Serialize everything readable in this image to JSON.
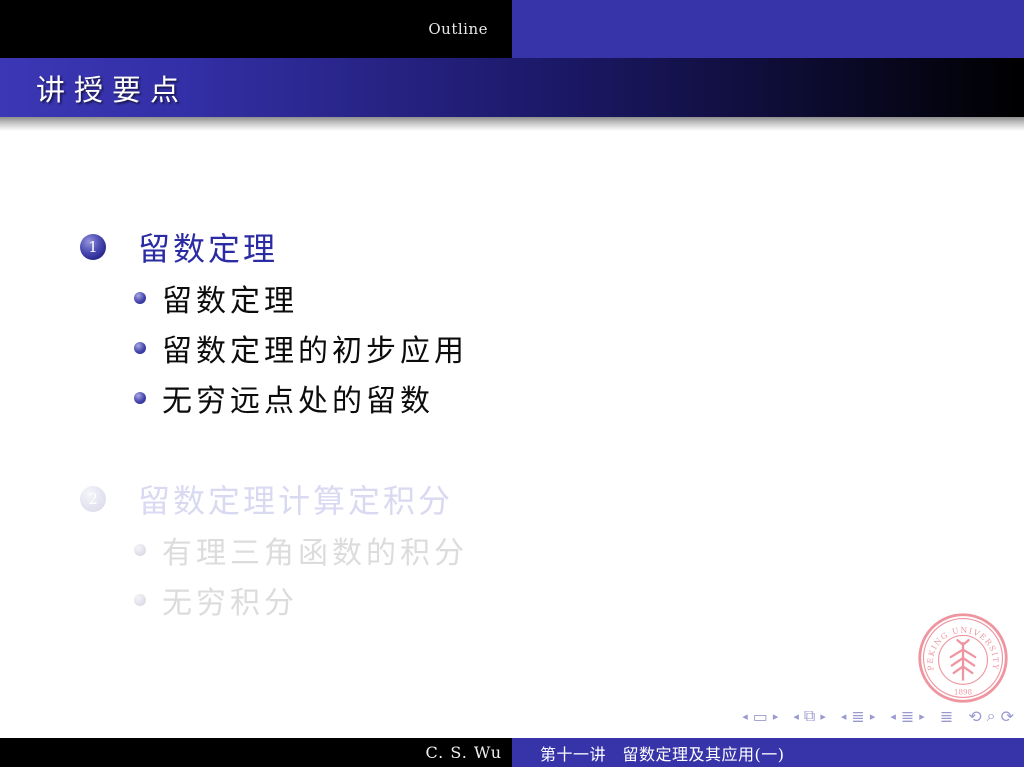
{
  "header": {
    "section_label": "Outline",
    "frame_title": "讲授要点"
  },
  "toc": {
    "sections": [
      {
        "number": "1",
        "title": "留数定理",
        "state": "active",
        "items": [
          "留数定理",
          "留数定理的初步应用",
          "无穷远点处的留数"
        ]
      },
      {
        "number": "2",
        "title": "留数定理计算定积分",
        "state": "faded",
        "items": [
          "有理三角函数的积分",
          "无穷积分"
        ]
      }
    ]
  },
  "navigation": {
    "glyphs": {
      "prev": "◂",
      "next": "▸",
      "slide": "▭",
      "frame": "⧉",
      "subsection": "≣",
      "section": "≣",
      "appendix": "≣",
      "back": "⟲",
      "search": "⌕",
      "forward": "⟳"
    }
  },
  "logo": {
    "ring_text": "PEKING UNIVERSITY",
    "year": "1898"
  },
  "footer": {
    "author": "C. S. Wu",
    "lecture": "第十一讲　留数定理及其应用(一)"
  },
  "colors": {
    "structure_blue": "#3733a9",
    "active_section_text": "#2b2ba3",
    "faded_section_text": "#d9d9f2",
    "faded_item_text": "#dcdcdc",
    "nav_symbols": "#9a9ad0",
    "logo_red": "#ec8794"
  }
}
